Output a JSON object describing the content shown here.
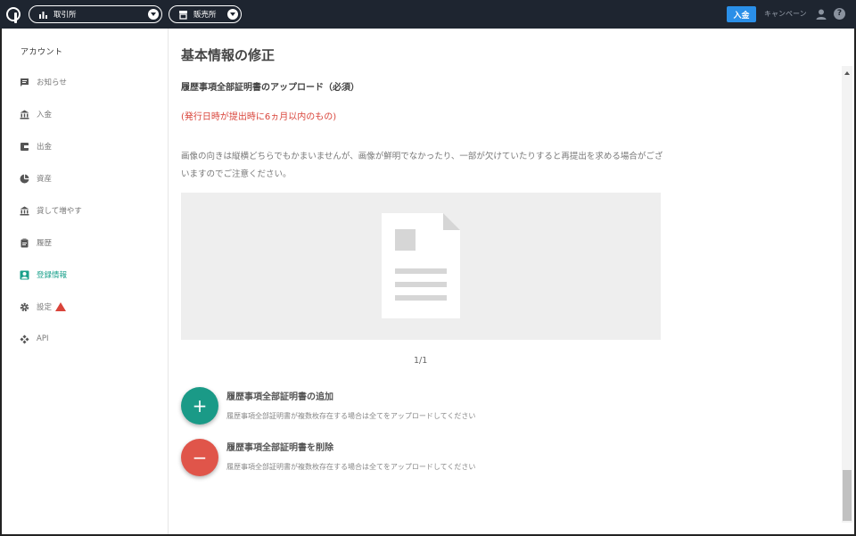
{
  "topbar": {
    "exchange_label": "取引所",
    "shop_label": "販売所",
    "deposit_label": "入金",
    "campaign_label": "キャンペーン",
    "help_symbol": "?",
    "accent_color": "#2a8fe8",
    "bg_color": "#1e2530"
  },
  "sidebar": {
    "title": "アカウント",
    "items": [
      {
        "label": "お知らせ",
        "icon": "message-icon"
      },
      {
        "label": "入金",
        "icon": "bank-icon"
      },
      {
        "label": "出金",
        "icon": "wallet-icon"
      },
      {
        "label": "資産",
        "icon": "pie-icon"
      },
      {
        "label": "貸して増やす",
        "icon": "bank-icon"
      },
      {
        "label": "履歴",
        "icon": "clipboard-icon"
      },
      {
        "label": "登録情報",
        "icon": "account-box-icon",
        "active": true
      },
      {
        "label": "設定",
        "icon": "gear-icon",
        "warning": true
      },
      {
        "label": "API",
        "icon": "api-icon"
      }
    ],
    "active_color": "#1aa08b"
  },
  "main": {
    "page_title": "基本情報の修正",
    "section_title": "履歴事項全部証明書のアップロード（必須）",
    "red_note": "(発行日時が提出時に6ヵ月以内のもの)",
    "description": "画像の向きは縦横どちらでもかまいませんが、画像が鮮明でなかったり、一部が欠けていたりすると再提出を求める場合がございますのでご注意ください。",
    "page_count": "1/1",
    "add_action": {
      "symbol": "+",
      "title": "履歴事項全部証明書の追加",
      "subtitle": "履歴事項全部証明書が複数枚存在する場合は全てをアップロードしてください"
    },
    "remove_action": {
      "symbol": "−",
      "title": "履歴事項全部証明書を削除",
      "subtitle": "履歴事項全部証明書が複数枚存在する場合は全てをアップロードしてください"
    }
  }
}
